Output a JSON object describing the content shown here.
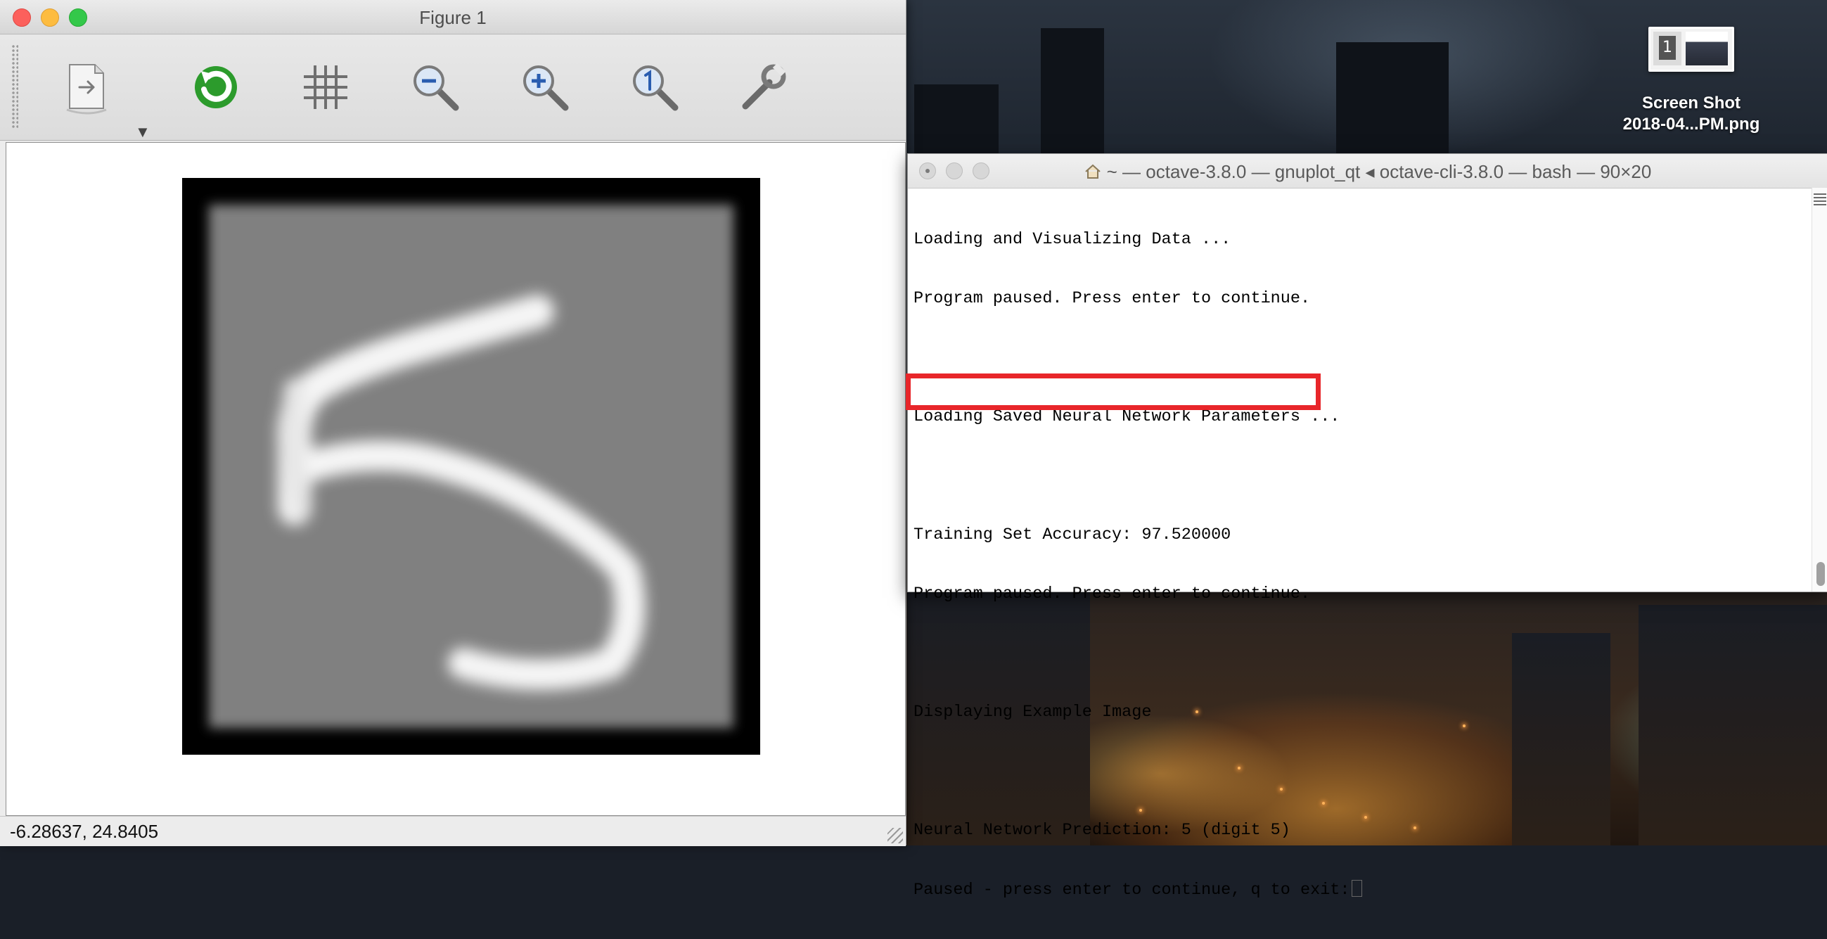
{
  "figure_window": {
    "title": "Figure 1",
    "toolbar": {
      "export_icon": "export-document-icon",
      "export_dropdown": "▼",
      "refresh_icon": "refresh-icon",
      "grid_icon": "grid-icon",
      "zoom_out_icon": "zoom-out-icon",
      "zoom_in_icon": "zoom-in-icon",
      "zoom_reset_icon": "zoom-reset-icon",
      "settings_icon": "wrench-icon"
    },
    "plot": {
      "description": "grayscale handwritten digit",
      "colors": {
        "border": "#000000",
        "background": "#808080",
        "stroke": "#f5f5f5"
      }
    },
    "status": {
      "coordinates": "-6.28637,  24.8405"
    }
  },
  "terminal_window": {
    "title": "~ — octave-3.8.0 — gnuplot_qt ◂ octave-cli-3.8.0 — bash — 90×20",
    "lines": [
      "Loading and Visualizing Data ...",
      "Program paused. Press enter to continue.",
      "",
      "Loading Saved Neural Network Parameters ...",
      "",
      "Training Set Accuracy: 97.520000",
      "Program paused. Press enter to continue.",
      "",
      "Displaying Example Image",
      "",
      "Neural Network Prediction: 5 (digit 5)",
      "Paused - press enter to continue, q to exit:"
    ],
    "highlight_color": "#e8262a"
  },
  "desktop": {
    "file_label_line1": "Screen Shot",
    "file_label_line2": "2018-04...PM.png",
    "thumbnail_number": "1"
  }
}
